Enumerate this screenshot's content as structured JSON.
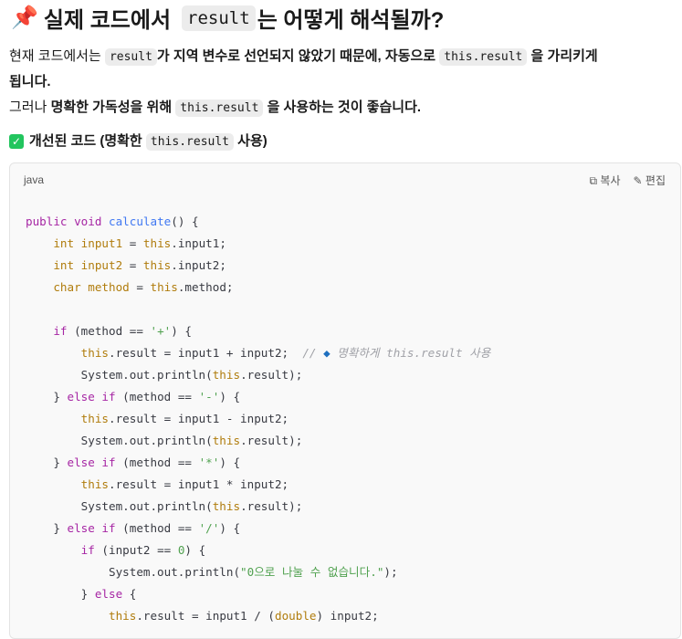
{
  "heading": {
    "icon": "📌",
    "pre": "실제 코드에서",
    "code": "result",
    "post": "는 어떻게 해석될까?"
  },
  "para1": {
    "a": "현재 코드에서는",
    "code1": "result",
    "b": "가 지역 변수로 선언되지 않았기 때문에, 자동으로",
    "code2": "this.result",
    "c": "을 가리키게",
    "d": "됩니다."
  },
  "para2": {
    "a": "그러나",
    "bold": "명확한 가독성",
    "b": "을 위해",
    "code": "this.result",
    "c": "을 사용하는 것이 좋습니다."
  },
  "subheading": {
    "pre": "개선된 코드 (명확한",
    "code": "this.result",
    "post": "사용)"
  },
  "codeblock": {
    "language": "java",
    "copy_label": "복사",
    "edit_label": "편집",
    "lines": [
      [
        [
          "kw",
          "public void "
        ],
        [
          "fn",
          "calculate"
        ],
        [
          "",
          "() {"
        ]
      ],
      [
        [
          "ty",
          "    int input1"
        ],
        [
          "",
          " = "
        ],
        [
          "ty",
          "this"
        ],
        [
          "",
          ".input1;"
        ]
      ],
      [
        [
          "ty",
          "    int input2"
        ],
        [
          "",
          " = "
        ],
        [
          "ty",
          "this"
        ],
        [
          "",
          ".input2;"
        ]
      ],
      [
        [
          "ty",
          "    char method"
        ],
        [
          "",
          " = "
        ],
        [
          "ty",
          "this"
        ],
        [
          "",
          ".method;"
        ]
      ],
      [],
      [
        [
          "kw",
          "    if"
        ],
        [
          "",
          " (method == "
        ],
        [
          "st",
          "'+'"
        ],
        [
          "",
          ") {"
        ]
      ],
      [
        [
          "ty",
          "        this"
        ],
        [
          "",
          ".result = input1 + input2;  "
        ],
        [
          "cm",
          "// "
        ],
        [
          "dm",
          "◆"
        ],
        [
          "cm",
          " 명확하게 this.result 사용"
        ]
      ],
      [
        [
          "",
          "        System.out.println("
        ],
        [
          "ty",
          "this"
        ],
        [
          "",
          ".result);"
        ]
      ],
      [
        [
          "",
          "    } "
        ],
        [
          "kw",
          "else if"
        ],
        [
          "",
          " (method == "
        ],
        [
          "st",
          "'-'"
        ],
        [
          "",
          ") {"
        ]
      ],
      [
        [
          "ty",
          "        this"
        ],
        [
          "",
          ".result = input1 - input2;"
        ]
      ],
      [
        [
          "",
          "        System.out.println("
        ],
        [
          "ty",
          "this"
        ],
        [
          "",
          ".result);"
        ]
      ],
      [
        [
          "",
          "    } "
        ],
        [
          "kw",
          "else if"
        ],
        [
          "",
          " (method == "
        ],
        [
          "st",
          "'*'"
        ],
        [
          "",
          ") {"
        ]
      ],
      [
        [
          "ty",
          "        this"
        ],
        [
          "",
          ".result = input1 * input2;"
        ]
      ],
      [
        [
          "",
          "        System.out.println("
        ],
        [
          "ty",
          "this"
        ],
        [
          "",
          ".result);"
        ]
      ],
      [
        [
          "",
          "    } "
        ],
        [
          "kw",
          "else if"
        ],
        [
          "",
          " (method == "
        ],
        [
          "st",
          "'/'"
        ],
        [
          "",
          ") {"
        ]
      ],
      [
        [
          "kw",
          "        if"
        ],
        [
          "",
          " (input2 == "
        ],
        [
          "nm",
          "0"
        ],
        [
          "",
          ") {"
        ]
      ],
      [
        [
          "",
          "            System.out.println("
        ],
        [
          "st",
          "\"0으로 나눌 수 없습니다.\""
        ],
        [
          "",
          ");"
        ]
      ],
      [
        [
          "",
          "        } "
        ],
        [
          "kw",
          "else"
        ],
        [
          "",
          " {"
        ]
      ],
      [
        [
          "ty",
          "            this"
        ],
        [
          "",
          ".result = input1 / ("
        ],
        [
          "ty",
          "double"
        ],
        [
          "",
          ") input2;"
        ]
      ]
    ]
  }
}
